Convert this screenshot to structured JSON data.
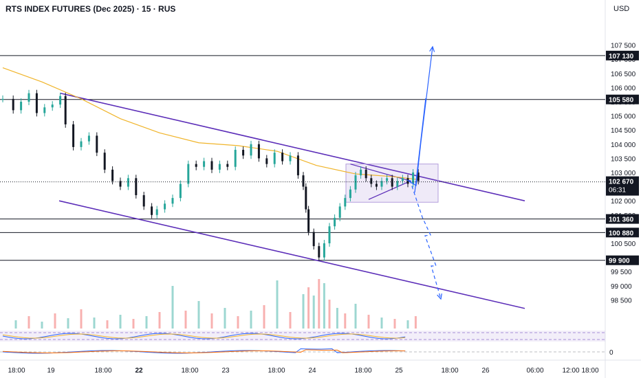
{
  "chart_data": {
    "type": "line",
    "title": "RTS INDEX FUTURES (Dec 2025) · 15 · RUS",
    "currency": "USD",
    "ylim": [
      98000,
      108000
    ],
    "y_ticks": [
      {
        "value": 107500,
        "label": "107 500"
      },
      {
        "value": 107000,
        "label": "107 000"
      },
      {
        "value": 106500,
        "label": "106 500"
      },
      {
        "value": 106000,
        "label": "106 000"
      },
      {
        "value": 105500,
        "label": "105 500"
      },
      {
        "value": 105000,
        "label": "105 000"
      },
      {
        "value": 104500,
        "label": "104 500"
      },
      {
        "value": 104000,
        "label": "104 000"
      },
      {
        "value": 103500,
        "label": "103 500"
      },
      {
        "value": 103000,
        "label": "103 000"
      },
      {
        "value": 102000,
        "label": "102 000"
      },
      {
        "value": 101500,
        "label": "101 500"
      },
      {
        "value": 100500,
        "label": "100 500"
      },
      {
        "value": 99500,
        "label": "99 500"
      },
      {
        "value": 99000,
        "label": "99 000"
      },
      {
        "value": 98500,
        "label": "98 500"
      }
    ],
    "x_ticks": [
      {
        "label": "18:00",
        "bold": false
      },
      {
        "label": "19",
        "bold": false
      },
      {
        "label": "18:00",
        "bold": false
      },
      {
        "label": "22",
        "bold": true
      },
      {
        "label": "18:00",
        "bold": false
      },
      {
        "label": "23",
        "bold": false
      },
      {
        "label": "18:00",
        "bold": false
      },
      {
        "label": "24",
        "bold": false
      },
      {
        "label": "18:00",
        "bold": false
      },
      {
        "label": "25",
        "bold": false
      },
      {
        "label": "18:00",
        "bold": false
      },
      {
        "label": "26",
        "bold": false
      },
      {
        "label": "06:00",
        "bold": false
      },
      {
        "label": "12:00",
        "bold": false
      },
      {
        "label": "18:00",
        "bold": false
      }
    ],
    "horizontal_levels": [
      {
        "value": 107130,
        "label": "107 130"
      },
      {
        "value": 105580,
        "label": "105 580"
      },
      {
        "value": 101360,
        "label": "101 360"
      },
      {
        "value": 100880,
        "label": "100 880"
      },
      {
        "value": 99900,
        "label": "99 900"
      }
    ],
    "last_price": {
      "value": 102670,
      "label": "102 670",
      "timer": "06:31"
    },
    "price_series": [
      {
        "bar": 0,
        "close": 105600
      },
      {
        "bar": 8,
        "close": 105200
      },
      {
        "bar": 14,
        "close": 105500
      },
      {
        "bar": 20,
        "close": 105800
      },
      {
        "bar": 26,
        "close": 105100
      },
      {
        "bar": 32,
        "close": 105300
      },
      {
        "bar": 38,
        "close": 105400
      },
      {
        "bar": 44,
        "close": 105700
      },
      {
        "bar": 48,
        "close": 104700
      },
      {
        "bar": 54,
        "close": 103900
      },
      {
        "bar": 60,
        "close": 104100
      },
      {
        "bar": 66,
        "close": 104300
      },
      {
        "bar": 72,
        "close": 103700
      },
      {
        "bar": 78,
        "close": 103100
      },
      {
        "bar": 84,
        "close": 102700
      },
      {
        "bar": 90,
        "close": 102500
      },
      {
        "bar": 96,
        "close": 102800
      },
      {
        "bar": 102,
        "close": 102200
      },
      {
        "bar": 108,
        "close": 101800
      },
      {
        "bar": 114,
        "close": 101500
      },
      {
        "bar": 118,
        "close": 101700
      },
      {
        "bar": 124,
        "close": 101900
      },
      {
        "bar": 130,
        "close": 102100
      },
      {
        "bar": 136,
        "close": 102600
      },
      {
        "bar": 142,
        "close": 103300
      },
      {
        "bar": 148,
        "close": 103200
      },
      {
        "bar": 154,
        "close": 103400
      },
      {
        "bar": 160,
        "close": 103100
      },
      {
        "bar": 166,
        "close": 103300
      },
      {
        "bar": 172,
        "close": 103200
      },
      {
        "bar": 178,
        "close": 103800
      },
      {
        "bar": 184,
        "close": 103600
      },
      {
        "bar": 190,
        "close": 104000
      },
      {
        "bar": 196,
        "close": 103500
      },
      {
        "bar": 202,
        "close": 103300
      },
      {
        "bar": 208,
        "close": 103700
      },
      {
        "bar": 214,
        "close": 103400
      },
      {
        "bar": 220,
        "close": 103600
      },
      {
        "bar": 226,
        "close": 102900
      },
      {
        "bar": 230,
        "close": 102500
      },
      {
        "bar": 232,
        "close": 101700
      },
      {
        "bar": 234,
        "close": 100900
      },
      {
        "bar": 238,
        "close": 100400
      },
      {
        "bar": 242,
        "close": 100000
      },
      {
        "bar": 246,
        "close": 100500
      },
      {
        "bar": 250,
        "close": 101100
      },
      {
        "bar": 254,
        "close": 101400
      },
      {
        "bar": 258,
        "close": 101800
      },
      {
        "bar": 262,
        "close": 102100
      },
      {
        "bar": 266,
        "close": 102400
      },
      {
        "bar": 270,
        "close": 102900
      },
      {
        "bar": 274,
        "close": 103100
      },
      {
        "bar": 278,
        "close": 102800
      },
      {
        "bar": 282,
        "close": 102600
      },
      {
        "bar": 286,
        "close": 102500
      },
      {
        "bar": 290,
        "close": 102700
      },
      {
        "bar": 294,
        "close": 102800
      },
      {
        "bar": 298,
        "close": 102500
      },
      {
        "bar": 302,
        "close": 102700
      },
      {
        "bar": 306,
        "close": 102800
      },
      {
        "bar": 310,
        "close": 102600
      },
      {
        "bar": 314,
        "close": 103000
      },
      {
        "bar": 318,
        "close": 102700
      }
    ],
    "ma_series": [
      {
        "bar": 0,
        "value": 106700
      },
      {
        "bar": 30,
        "value": 106200
      },
      {
        "bar": 60,
        "value": 105600
      },
      {
        "bar": 90,
        "value": 104900
      },
      {
        "bar": 120,
        "value": 104400
      },
      {
        "bar": 150,
        "value": 104050
      },
      {
        "bar": 180,
        "value": 103950
      },
      {
        "bar": 210,
        "value": 103750
      },
      {
        "bar": 240,
        "value": 103250
      },
      {
        "bar": 270,
        "value": 102950
      },
      {
        "bar": 300,
        "value": 102850
      },
      {
        "bar": 318,
        "value": 102750
      }
    ],
    "volume_series": [
      {
        "bar": 10,
        "value": 12
      },
      {
        "bar": 20,
        "value": 18
      },
      {
        "bar": 30,
        "value": 10
      },
      {
        "bar": 40,
        "value": 22
      },
      {
        "bar": 50,
        "value": 15
      },
      {
        "bar": 60,
        "value": 28
      },
      {
        "bar": 70,
        "value": 16
      },
      {
        "bar": 80,
        "value": 12
      },
      {
        "bar": 90,
        "value": 20
      },
      {
        "bar": 100,
        "value": 14
      },
      {
        "bar": 110,
        "value": 18
      },
      {
        "bar": 120,
        "value": 24
      },
      {
        "bar": 130,
        "value": 62
      },
      {
        "bar": 140,
        "value": 26
      },
      {
        "bar": 150,
        "value": 40
      },
      {
        "bar": 160,
        "value": 22
      },
      {
        "bar": 170,
        "value": 30
      },
      {
        "bar": 180,
        "value": 18
      },
      {
        "bar": 190,
        "value": 26
      },
      {
        "bar": 200,
        "value": 34
      },
      {
        "bar": 210,
        "value": 70
      },
      {
        "bar": 220,
        "value": 24
      },
      {
        "bar": 230,
        "value": 50
      },
      {
        "bar": 234,
        "value": 60
      },
      {
        "bar": 238,
        "value": 48
      },
      {
        "bar": 242,
        "value": 72
      },
      {
        "bar": 246,
        "value": 66
      },
      {
        "bar": 250,
        "value": 42
      },
      {
        "bar": 256,
        "value": 30
      },
      {
        "bar": 262,
        "value": 22
      },
      {
        "bar": 270,
        "value": 36
      },
      {
        "bar": 280,
        "value": 20
      },
      {
        "bar": 290,
        "value": 16
      },
      {
        "bar": 300,
        "value": 14
      },
      {
        "bar": 310,
        "value": 12
      },
      {
        "bar": 316,
        "value": 18
      }
    ],
    "oscillator_zero_label": "0",
    "grid": true
  }
}
